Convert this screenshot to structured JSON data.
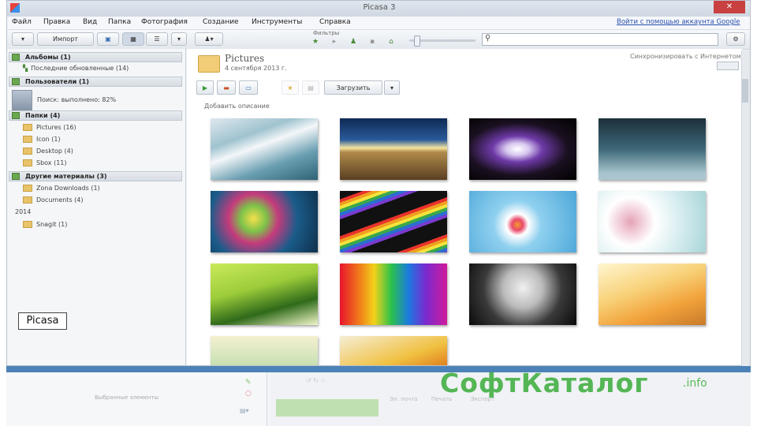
{
  "window": {
    "title": "Picasa 3",
    "close_label": "✕"
  },
  "menu": {
    "items": [
      "Файл",
      "Правка",
      "Вид",
      "Папка",
      "Фотография",
      "Создание",
      "Инструменты",
      "Справка"
    ],
    "signin": "Войти с помощью аккаунта Google"
  },
  "toolbar": {
    "import_label": "Импорт",
    "filters_label": "Фильтры",
    "search_placeholder": ""
  },
  "sidebar": {
    "albums_head": "Альбомы (1)",
    "albums": [
      "Последние обновленные (14)"
    ],
    "people_head": "Пользователи (1)",
    "people_status": "Поиск: выполнено: 82%",
    "folders_head": "Папки (4)",
    "folders": [
      "Pictures (16)",
      "Icon (1)",
      "Desktop (4)",
      "Sbox (11)"
    ],
    "other_head": "Другие материалы (3)",
    "other": [
      "Zona Downloads (1)",
      "Documents (4)"
    ],
    "year": "2014",
    "year_items": [
      "Snagit (1)"
    ]
  },
  "main": {
    "folder_title": "Pictures",
    "folder_date": "4 сентября 2013 г.",
    "sync_label": "Синхронизировать с Интернетом",
    "share_label": "Загрузить",
    "add_description": "Добавить описание"
  },
  "tray": {
    "selected_label": "Выбранные элементы",
    "upload_label": "",
    "icon_labels": [
      "Эл. почта",
      "Печать",
      "Экспорт"
    ]
  },
  "watermark": {
    "text": "СофтКаталог",
    "suffix": ".info"
  },
  "caption": "Picasa",
  "colors": {
    "accent_blue": "#4d82b8",
    "watermark_green": "#3fae3f",
    "section_green": "#6aa84f"
  }
}
